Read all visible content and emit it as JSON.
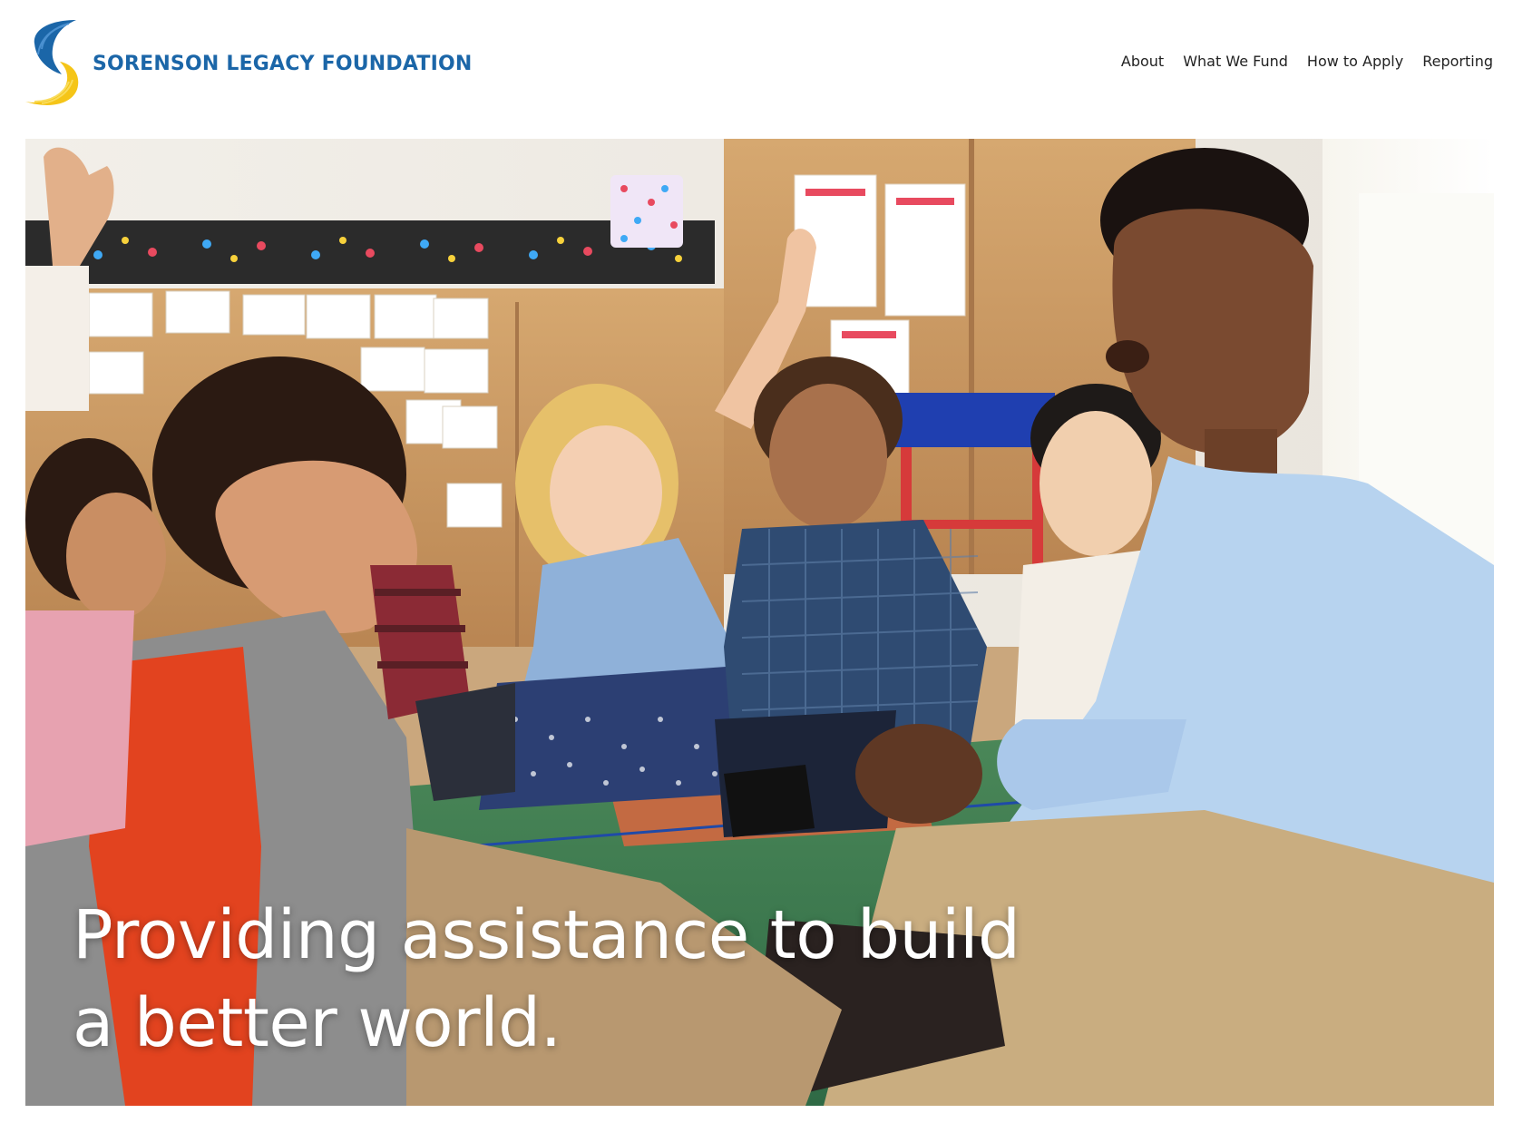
{
  "header": {
    "logo_text": "SORENSON LEGACY FOUNDATION",
    "logo_icon": "sorenson-swoosh-icon",
    "nav": [
      {
        "label": "About"
      },
      {
        "label": "What We Fund"
      },
      {
        "label": "How to Apply"
      },
      {
        "label": "Reporting"
      }
    ]
  },
  "hero": {
    "title": "Providing assistance to build a better world.",
    "image": "classroom-photo"
  },
  "colors": {
    "brand_blue": "#1b66a8",
    "brand_yellow": "#f5c518",
    "hero_text": "#ffffff",
    "nav_text": "#222222"
  }
}
